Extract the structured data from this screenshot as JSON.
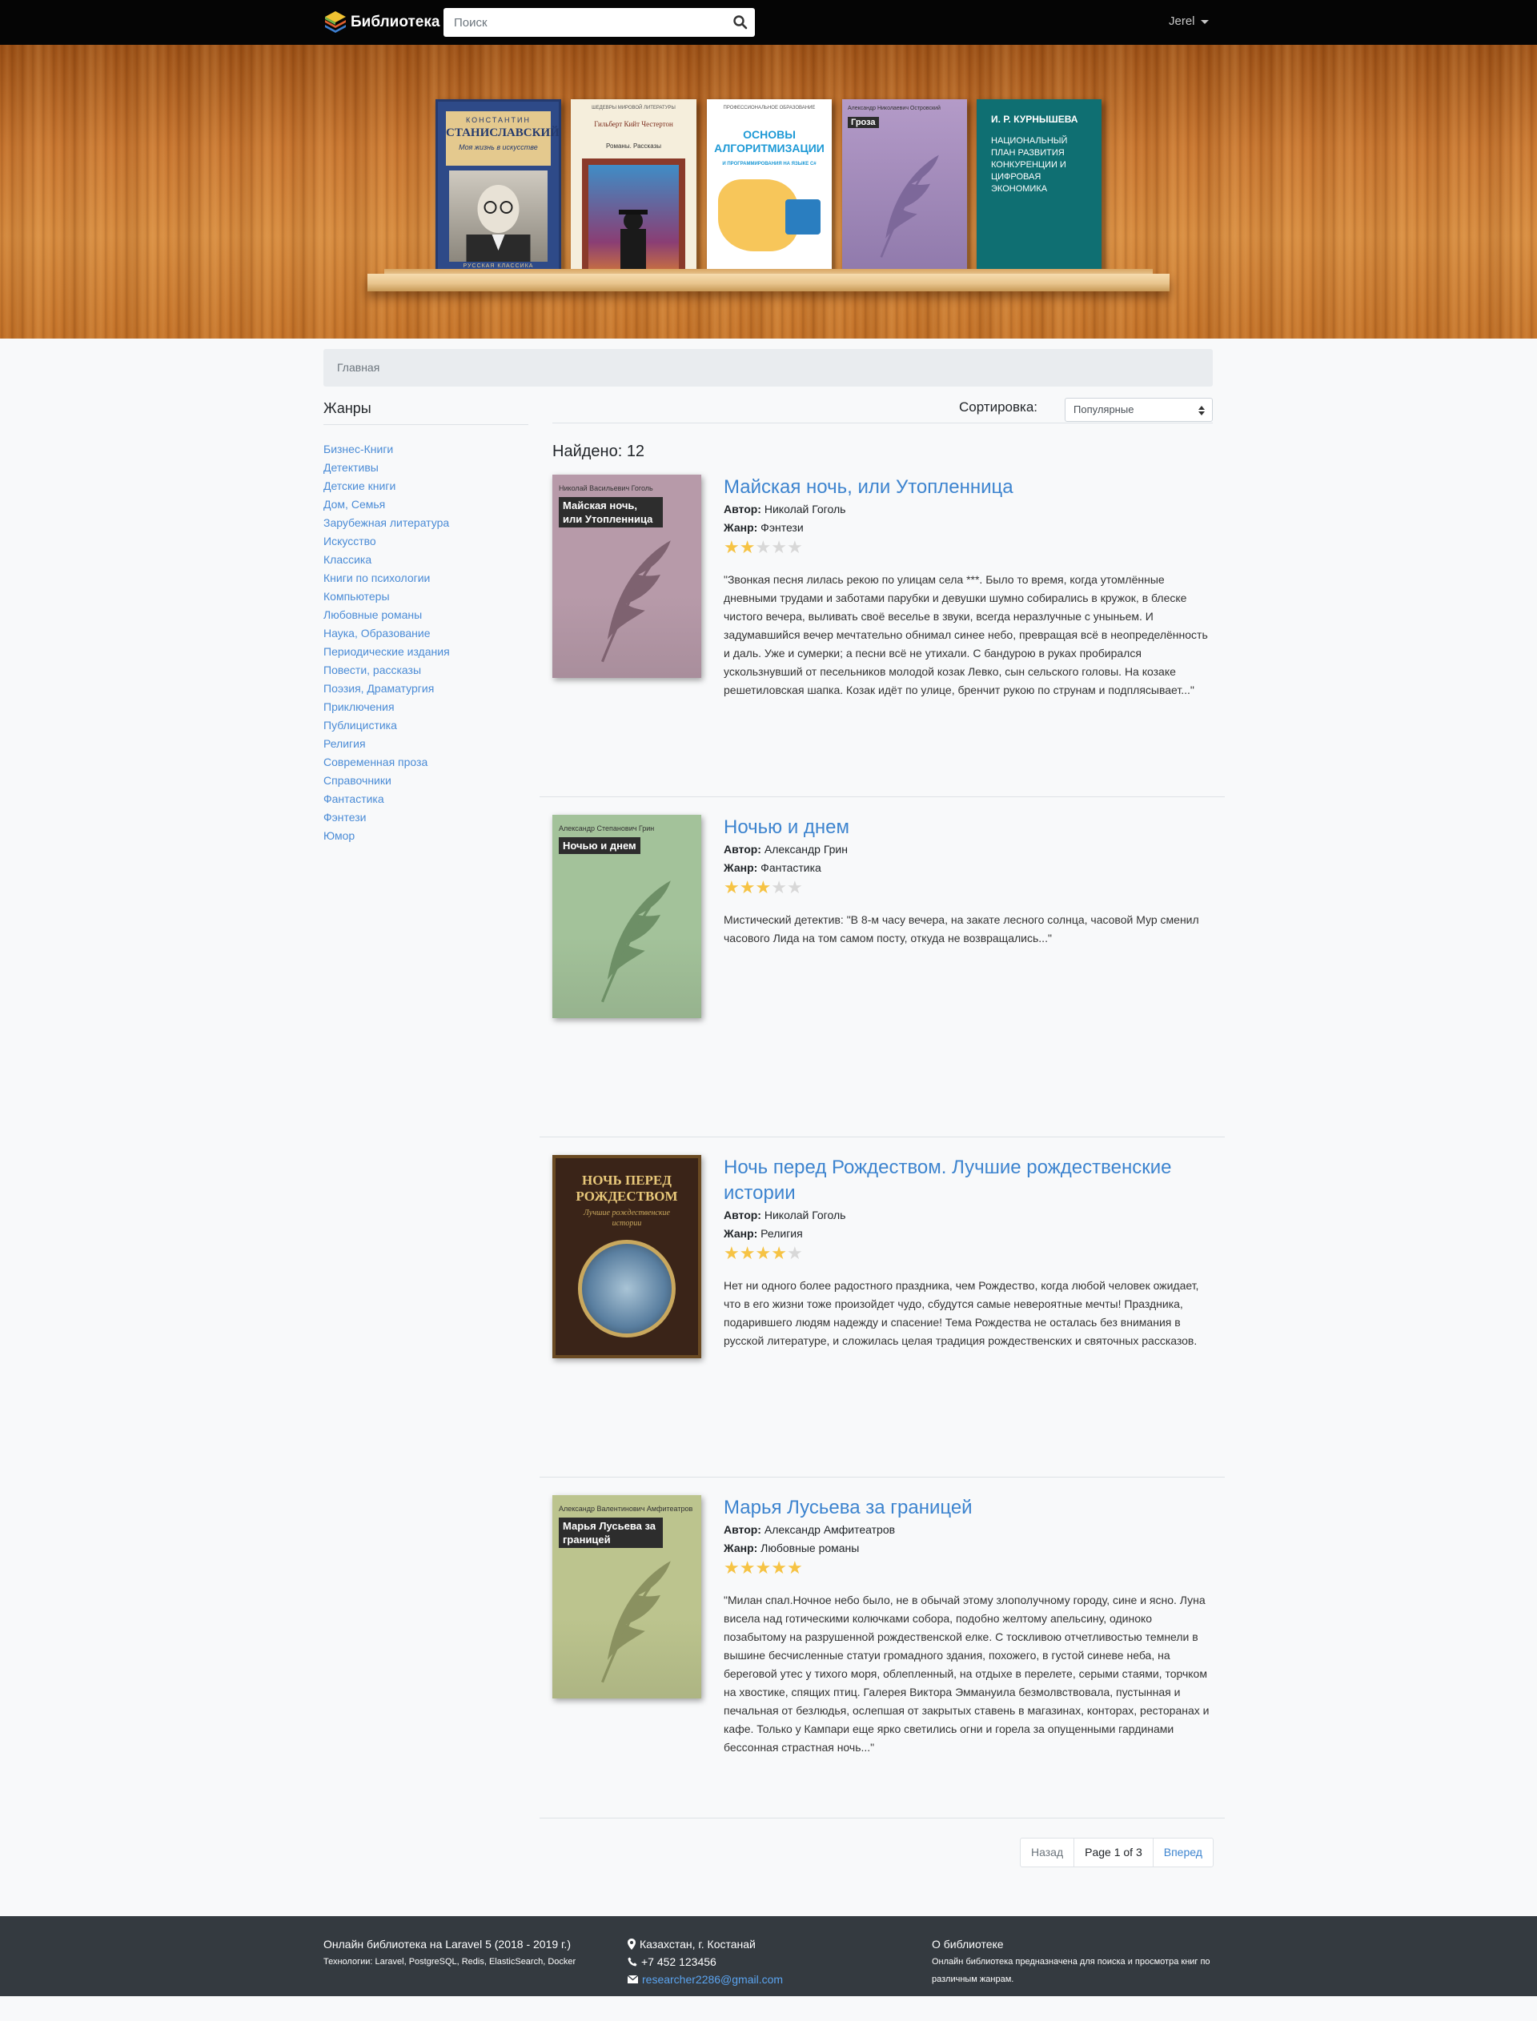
{
  "navbar": {
    "brand": "Библиотека",
    "search_placeholder": "Поиск",
    "user": "Jerel"
  },
  "breadcrumb": "Главная",
  "sidebar": {
    "title": "Жанры",
    "genres": [
      "Бизнес-Книги",
      "Детективы",
      "Детские книги",
      "Дом, Семья",
      "Зарубежная литература",
      "Искусство",
      "Классика",
      "Книги по психологии",
      "Компьютеры",
      "Любовные романы",
      "Наука, Образование",
      "Периодические издания",
      "Повести, рассказы",
      "Поэзия, Драматургия",
      "Приключения",
      "Публицистика",
      "Религия",
      "Современная проза",
      "Справочники",
      "Фантастика",
      "Фэнтези",
      "Юмор"
    ]
  },
  "sort": {
    "label": "Сортировка:",
    "selected": "Популярные"
  },
  "found": "Найдено: 12",
  "labels": {
    "author": "Автор:",
    "genre": "Жанр:"
  },
  "books": [
    {
      "title": "Майская ночь, или Утопленница",
      "author": "Николай Гоголь",
      "genre": "Фэнтези",
      "rating": 2,
      "cover_author": "Николай Васильевич Гоголь",
      "cover_title": "Майская ночь, или Утопленница",
      "cover_color": "#b79aa9",
      "desc": "\"Звонкая песня лилась рекою по улицам села ***. Было то время, когда утомлённые дневными трудами и заботами парубки и девушки шумно собирались в кружок, в блеске чистого вечера, выливать своё веселье в звуки, всегда неразлучные с уныньем. И задумавшийся вечер мечтательно обнимал синее небо, превращая всё в неопределённость и даль. Уже и сумерки; а песни всё не утихали. С бандурою в руках пробирался ускользнувший от песельников молодой козак Левко, сын сельского головы. На козаке решетиловская шапка. Козак идёт по улице, бренчит рукою по струнам и подплясывает...\""
    },
    {
      "title": "Ночью и днем",
      "author": "Александр Грин",
      "genre": "Фантастика",
      "rating": 3,
      "cover_author": "Александр Степанович Грин",
      "cover_title": "Ночью и днем",
      "cover_color": "#a3c29a",
      "desc": "Мистический детектив: \"В 8-м часу вечера, на закате лесного солнца, часовой Мур сменил часового Лида на том самом посту, откуда не возвращались...\""
    },
    {
      "title": "Ночь перед Рождеством. Лучшие рождественские истории",
      "author": "Николай Гоголь",
      "genre": "Религия",
      "rating": 4,
      "cover_author": "",
      "cover_title": "НОЧЬ ПЕРЕД РОЖДЕСТВОМ",
      "cover_subtitle": "Лучшие рождественские истории",
      "cover_color": "#3a2418",
      "desc": "Нет ни одного более радостного праздника, чем Рождество, когда любой человек ожидает, что в его жизни тоже произойдет чудо, сбудутся самые невероятные мечты! Праздника, подарившего людям надежду и спасение! Тема Рождества не осталась без внимания в русской литературе, и сложилась целая традиция рождественских и святочных рассказов."
    },
    {
      "title": "Марья Лусьева за границей",
      "author": "Александр Амфитеатров",
      "genre": "Любовные романы",
      "rating": 5,
      "cover_author": "Александр Валентинович Амфитеатров",
      "cover_title": "Марья Лусьева за границей",
      "cover_color": "#bcc48e",
      "desc": "\"Милан спал.Ночное небо было, не в обычай этому злополучному городу, сине и ясно. Луна висела над готическими колючками собора, подобно желтому апельсину, одиноко позабытому на разрушенной рождественской елке. С тоскливою отчетливостью темнели в вышине бесчисленные статуи громадного здания, похожего, в густой синеве неба, на береговой утес у тихого моря, облепленный, на отдыхе в перелете, серыми стаями, торчком на хвостике, спящих птиц. Галерея Виктора Эммануила безмолвствовала, пустынная и печальная от безлюдья, ослепшая от закрытых ставень в магазинах, конторах, ресторанах и кафе. Только у Кампари еще ярко светились огни и горела за опущенными гардинами бессонная страстная ночь...\""
    }
  ],
  "pagination": {
    "prev": "Назад",
    "current": "Page 1 of 3",
    "next": "Вперед"
  },
  "hero_books": {
    "b1_author": "КОНСТАНТИН",
    "b1_title": "СТАНИСЛАВСКИЙ",
    "b1_subtitle": "Моя жизнь в искусстве",
    "b1_footer": "РУССКАЯ КЛАССИКА",
    "b2_series": "ШЕДЕВРЫ МИРОВОЙ ЛИТЕРАТУРЫ",
    "b2_author": "Гильберт Кийт Честертон",
    "b2_sub": "Романы. Рассказы",
    "b3_top": "ПРОФЕССИОНАЛЬНОЕ ОБРАЗОВАНИЕ",
    "b3_title": "ОСНОВЫ АЛГОРИТМИЗАЦИИ",
    "b3_sub": "И ПРОГРАММИРОВАНИЯ НА ЯЗЫКЕ C#",
    "b4_author": "Александр Николаевич Островский",
    "b4_title": "Гроза",
    "b5_author": "И. Р. КУРНЫШЕВА",
    "b5_title": "НАЦИОНАЛЬНЫЙ ПЛАН РАЗВИТИЯ КОНКУРЕНЦИИ И ЦИФРОВАЯ ЭКОНОМИКА"
  },
  "footer": {
    "col1_title": "Онлайн библиотека на Laravel 5 (2018 - 2019 г.)",
    "col1_sub": "Технологии: Laravel, PostgreSQL, Redis, ElasticSearch, Docker",
    "location": "Казахстан, г. Костанай",
    "phone": "+7 452 123456",
    "email": "researcher2286@gmail.com",
    "col3_title": "О библиотеке",
    "col3_sub": "Онлайн библиотека предназначена для поиска и просмотра книг по различным жанрам."
  }
}
